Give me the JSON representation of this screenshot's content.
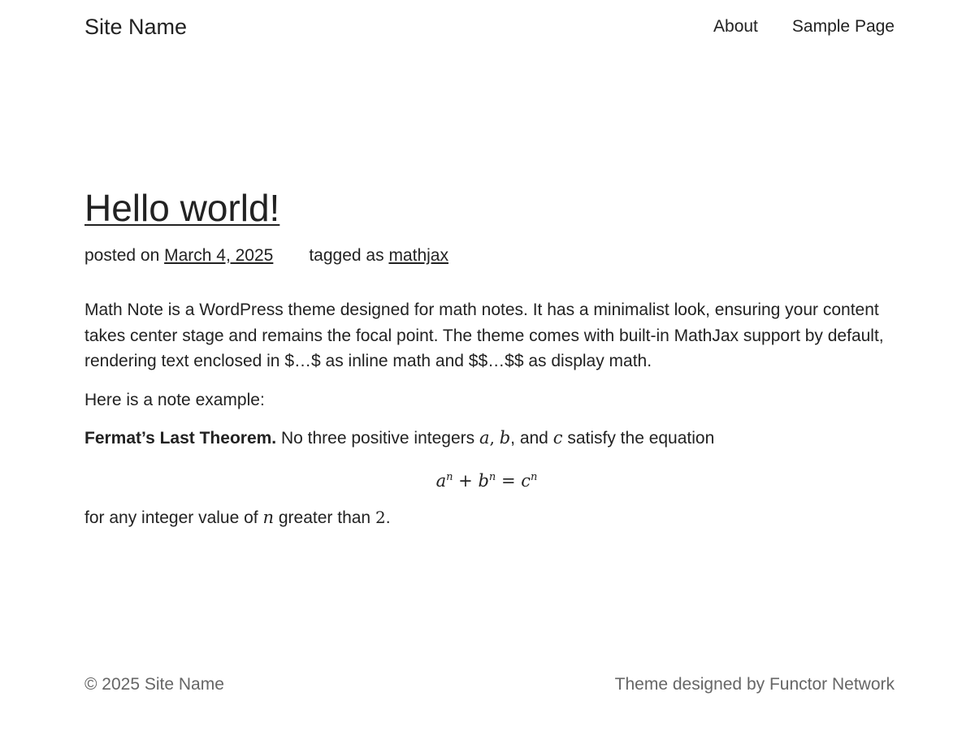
{
  "header": {
    "site_name": "Site Name",
    "nav": [
      {
        "label": "About"
      },
      {
        "label": "Sample Page"
      }
    ]
  },
  "post": {
    "title": "Hello world!",
    "meta": {
      "posted_prefix": "posted on",
      "date": "March 4, 2025",
      "tagged_prefix": "tagged as",
      "tag": "mathjax"
    },
    "intro": "Math Note is a WordPress theme designed for math notes. It has a minimalist look, ensuring your content takes center stage and remains the focal point. The theme comes with built-in MathJax support by default, rendering text enclosed in $…$ as inline math and $$…$$ as display math.",
    "example_line": "Here is a note example:",
    "theorem": {
      "name": "Fermat’s Last Theorem.",
      "text_before": "No three positive integers",
      "var_a": "a",
      "sep1": ",",
      "var_b": "b",
      "sep2": ", and",
      "var_c": "c",
      "text_after": "satisfy the equation"
    },
    "equation": {
      "a": "a",
      "exp1": "n",
      "plus": "+",
      "b": "b",
      "exp2": "n",
      "equals": "=",
      "c": "c",
      "exp3": "n"
    },
    "closing": {
      "text_before": "for any integer value of",
      "var_n": "n",
      "text_middle": "greater than",
      "number": "2",
      "text_end": "."
    }
  },
  "footer": {
    "copyright": "© 2025 Site Name",
    "credit": "Theme designed by Functor Network"
  }
}
